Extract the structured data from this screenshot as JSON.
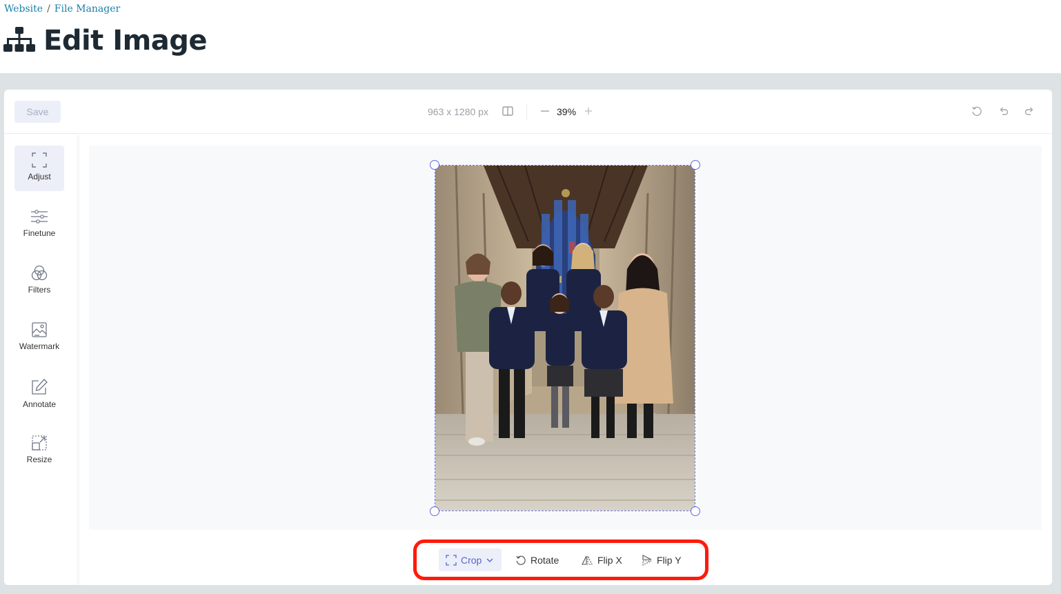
{
  "breadcrumb": {
    "items": [
      "Website",
      "File Manager"
    ],
    "separator": "/"
  },
  "page": {
    "title": "Edit Image"
  },
  "toolbar": {
    "save_label": "Save",
    "dimensions": "963 x 1280 px",
    "zoom": "39%",
    "zoom_out_icon": "minus-icon",
    "zoom_in_icon": "plus-icon",
    "compare_icon": "compare-icon",
    "history_icons": [
      "reset-icon",
      "undo-icon",
      "redo-icon"
    ]
  },
  "sidebar": {
    "items": [
      {
        "label": "Adjust",
        "icon": "crop-frame-icon",
        "active": true
      },
      {
        "label": "Finetune",
        "icon": "sliders-icon",
        "active": false
      },
      {
        "label": "Filters",
        "icon": "color-circles-icon",
        "active": false
      },
      {
        "label": "Watermark",
        "icon": "image-watermark-icon",
        "active": false
      },
      {
        "label": "Annotate",
        "icon": "pencil-square-icon",
        "active": false
      },
      {
        "label": "Resize",
        "icon": "resize-icon",
        "active": false
      }
    ]
  },
  "adjust_actions": [
    {
      "label": "Crop",
      "icon": "crop-frame-icon",
      "active": true,
      "dropdown": true
    },
    {
      "label": "Rotate",
      "icon": "rotate-icon",
      "active": false
    },
    {
      "label": "Flip X",
      "icon": "flip-x-icon",
      "active": false
    },
    {
      "label": "Flip Y",
      "icon": "flip-y-icon",
      "active": false
    }
  ],
  "colors": {
    "accent": "#5f6ae0",
    "highlight_outline": "#ff1a0a",
    "link": "#1a7fa6",
    "title": "#1e2a33"
  }
}
